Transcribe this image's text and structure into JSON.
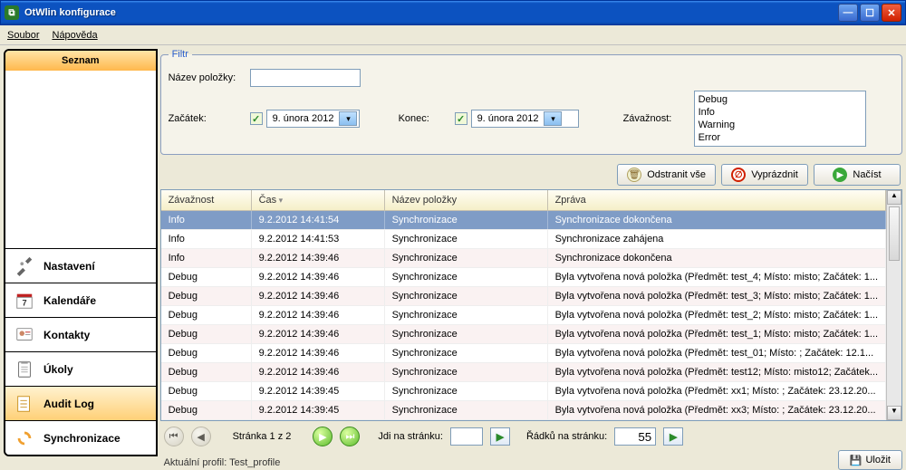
{
  "window": {
    "title": "OtWlin konfigurace"
  },
  "menu": {
    "soubor": "Soubor",
    "napoveda": "Nápověda"
  },
  "sidebar": {
    "header": "Seznam",
    "items": [
      {
        "label": "Nastavení"
      },
      {
        "label": "Kalendáře"
      },
      {
        "label": "Kontakty"
      },
      {
        "label": "Úkoly"
      },
      {
        "label": "Audit Log"
      },
      {
        "label": "Synchronizace"
      }
    ]
  },
  "filter": {
    "legend": "Filtr",
    "name_label": "Název položky:",
    "name_value": "",
    "start_label": "Začátek:",
    "start_value": "9.   února    2012",
    "end_label": "Konec:",
    "end_value": "9.   února    2012",
    "sev_label": "Závažnost:",
    "sev_options": [
      "Debug",
      "Info",
      "Warning",
      "Error"
    ]
  },
  "buttons": {
    "delete_all": "Odstranit vše",
    "empty": "Vyprázdnit",
    "load": "Načíst",
    "save": "Uložit"
  },
  "grid": {
    "cols": {
      "c1": "Závažnost",
      "c2": "Čas",
      "c3": "Název položky",
      "c4": "Zpráva"
    },
    "rows": [
      {
        "sev": "Info",
        "time": "9.2.2012 14:41:54",
        "name": "Synchronizace",
        "msg": "Synchronizace dokončena"
      },
      {
        "sev": "Info",
        "time": "9.2.2012 14:41:53",
        "name": "Synchronizace",
        "msg": "Synchronizace zahájena"
      },
      {
        "sev": "Info",
        "time": "9.2.2012 14:39:46",
        "name": "Synchronizace",
        "msg": "Synchronizace dokončena"
      },
      {
        "sev": "Debug",
        "time": "9.2.2012 14:39:46",
        "name": "Synchronizace",
        "msg": "Byla vytvořena nová položka (Předmět: test_4; Místo: misto; Začátek: 1..."
      },
      {
        "sev": "Debug",
        "time": "9.2.2012 14:39:46",
        "name": "Synchronizace",
        "msg": "Byla vytvořena nová položka (Předmět: test_3; Místo: misto; Začátek: 1..."
      },
      {
        "sev": "Debug",
        "time": "9.2.2012 14:39:46",
        "name": "Synchronizace",
        "msg": "Byla vytvořena nová položka (Předmět: test_2; Místo: misto; Začátek: 1..."
      },
      {
        "sev": "Debug",
        "time": "9.2.2012 14:39:46",
        "name": "Synchronizace",
        "msg": "Byla vytvořena nová položka (Předmět: test_1; Místo: misto; Začátek: 1..."
      },
      {
        "sev": "Debug",
        "time": "9.2.2012 14:39:46",
        "name": "Synchronizace",
        "msg": "Byla vytvořena nová položka (Předmět: test_01; Místo: ; Začátek: 12.1..."
      },
      {
        "sev": "Debug",
        "time": "9.2.2012 14:39:46",
        "name": "Synchronizace",
        "msg": "Byla vytvořena nová položka (Předmět: test12; Místo: misto12; Začátek..."
      },
      {
        "sev": "Debug",
        "time": "9.2.2012 14:39:45",
        "name": "Synchronizace",
        "msg": "Byla vytvořena nová položka (Předmět: xx1; Místo: ; Začátek: 23.12.20..."
      },
      {
        "sev": "Debug",
        "time": "9.2.2012 14:39:45",
        "name": "Synchronizace",
        "msg": "Byla vytvořena nová položka (Předmět: xx3; Místo: ; Začátek: 23.12.20..."
      }
    ]
  },
  "pager": {
    "page_text": "Stránka 1 z 2",
    "goto_label": "Jdi na stránku:",
    "goto_value": "",
    "rows_label": "Řádků na stránku:",
    "rows_value": "55"
  },
  "status": {
    "profile": "Aktuální profil: Test_profile"
  }
}
